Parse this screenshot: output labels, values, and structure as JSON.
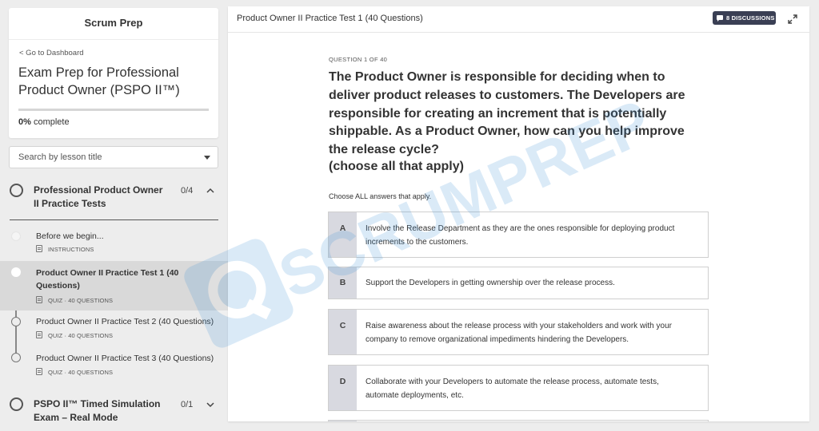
{
  "sidebar": {
    "brand": "Scrum Prep",
    "back_link": "< Go to Dashboard",
    "course_title": "Exam Prep for Professional Product Owner (PSPO II™)",
    "progress_value": "0%",
    "progress_suffix": "complete",
    "progress_fraction": 0,
    "search_placeholder": "Search by lesson title",
    "sections": [
      {
        "title": "Professional Product Owner II Practice Tests",
        "count": "0/4",
        "expanded": true,
        "lessons": [
          {
            "title": "Before we begin...",
            "meta": "INSTRUCTIONS",
            "active": false
          },
          {
            "title": "Product Owner II Practice Test 1 (40 Questions)",
            "meta": "QUIZ · 40 QUESTIONS",
            "active": true
          },
          {
            "title": "Product Owner II Practice Test 2 (40 Questions)",
            "meta": "QUIZ · 40 QUESTIONS",
            "active": false
          },
          {
            "title": "Product Owner II Practice Test 3 (40 Questions)",
            "meta": "QUIZ · 40 QUESTIONS",
            "active": false
          }
        ]
      },
      {
        "title": "PSPO II™ Timed Simulation Exam – Real Mode",
        "count": "0/1",
        "expanded": false
      }
    ]
  },
  "main": {
    "title": "Product Owner II Practice Test 1 (40 Questions)",
    "discussions_label": "8 DISCUSSIONS",
    "question_number": "QUESTION 1 OF 40",
    "question_text": "The Product Owner is responsible for deciding when to deliver product releases to customers. The Developers are responsible for creating an increment that is potentially shippable. As a Product Owner, how can you help improve the release cycle?",
    "instruction": "(choose all that apply)",
    "hint": "Choose ALL answers that apply.",
    "options": [
      {
        "letter": "A",
        "text": "Involve the Release Department as they are the ones responsible for deploying product increments to the customers."
      },
      {
        "letter": "B",
        "text": "Support the Developers in getting ownership over the release process."
      },
      {
        "letter": "C",
        "text": "Raise awareness about the release process with your stakeholders and work with your company to remove organizational impediments hindering the Developers."
      },
      {
        "letter": "D",
        "text": "Collaborate with your Developers to automate the release process, automate tests, automate deployments, etc."
      }
    ],
    "watermark_text": "SCRUMPREP"
  },
  "colors": {
    "accent_dark": "#3a3f54",
    "option_letter_bg": "#d8d9e0",
    "active_lesson_bg": "#d9d9d9",
    "watermark": "#7fb8e6"
  }
}
